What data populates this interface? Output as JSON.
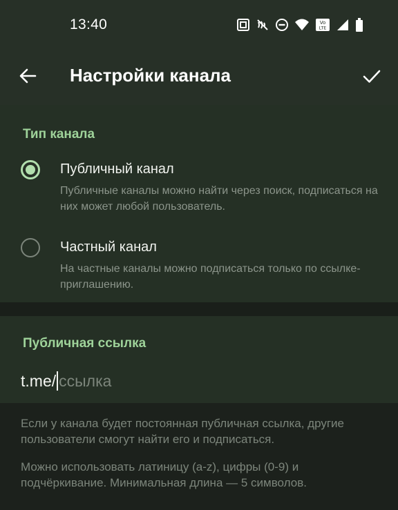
{
  "status_bar": {
    "time": "13:40",
    "icons": [
      "nfc-icon",
      "vibrate-off-icon",
      "do-not-disturb-icon",
      "wifi-icon",
      "volte-icon",
      "signal-icon",
      "battery-icon"
    ]
  },
  "app_bar": {
    "title": "Настройки канала"
  },
  "channel_type": {
    "header": "Тип канала",
    "options": [
      {
        "label": "Публичный канал",
        "description": "Публичные каналы можно найти через поиск, подписаться на них может любой пользователь.",
        "selected": true
      },
      {
        "label": "Частный канал",
        "description": "На частные каналы можно подписаться только по ссылке-приглашению.",
        "selected": false
      }
    ]
  },
  "public_link": {
    "header": "Публичная ссылка",
    "prefix": "t.me/",
    "value": "",
    "placeholder": "ссылка"
  },
  "help": {
    "paragraph1": "Если у канала будет постоянная публичная ссылка, другие пользователи смогут найти его и подписаться.",
    "paragraph2": "Можно использовать латиницу (a-z), цифры (0-9) и подчёркивание. Минимальная длина — 5 символов."
  },
  "colors": {
    "accent": "#9fd39a",
    "radio_checked": "#b2dfae",
    "background": "#1c211c",
    "surface": "#253025"
  }
}
